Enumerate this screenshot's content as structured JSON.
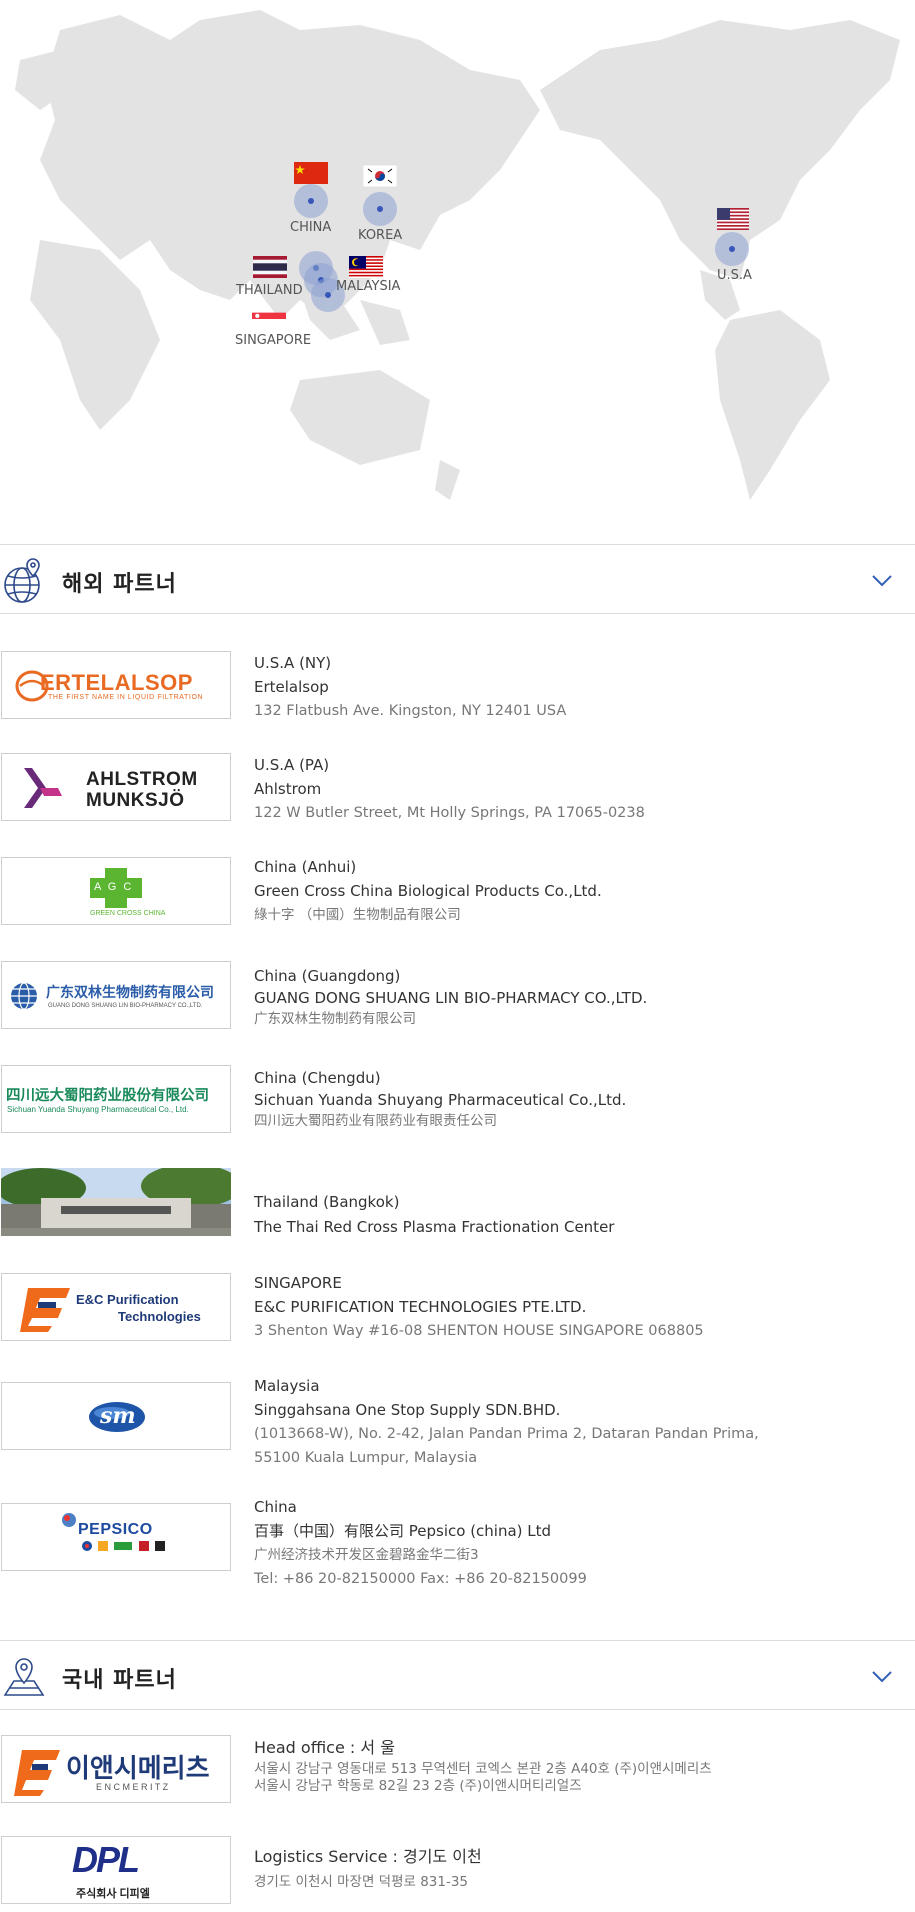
{
  "map": {
    "markers": [
      {
        "label": "CHINA",
        "flag": "china-flag"
      },
      {
        "label": "KOREA",
        "flag": "korea-flag"
      },
      {
        "label": "THAILAND",
        "flag": "thailand-flag"
      },
      {
        "label": "MALAYSIA",
        "flag": "malaysia-flag"
      },
      {
        "label": "SINGAPORE",
        "flag": "singapore-flag"
      },
      {
        "label": "U.S.A",
        "flag": "usa-flag"
      }
    ]
  },
  "overseas": {
    "title": "해외 파트너",
    "icon": "globe-pin-icon",
    "partners": [
      {
        "logo": "ertelalsop-logo",
        "logo_text": "ERTELALSOP",
        "logo_sub": "THE FIRST NAME IN LIQUID FILTRATION",
        "region": "U.S.A (NY)",
        "name": "Ertelalsop",
        "address": "132 Flatbush Ave. Kingston, NY 12401 USA"
      },
      {
        "logo": "ahlstrom-logo",
        "logo_text": "AHLSTROM",
        "logo_sub": "MUNKSJÖ",
        "region": "U.S.A (PA)",
        "name": "Ahlstrom",
        "address": "122 W Butler Street, Mt Holly Springs, PA 17065-0238"
      },
      {
        "logo": "green-cross-logo",
        "logo_text": "A G C",
        "logo_sub": "GREEN CROSS CHINA",
        "region": "China (Anhui)",
        "name": "Green Cross China  Biological Products Co.,Ltd.",
        "address": "綠十字 （中國）生物制品有限公司"
      },
      {
        "logo": "shuanglin-logo",
        "logo_text": "广东双林生物制药有限公司",
        "logo_sub": "GUANG DONG SHUANG LIN BIO-PHARMACY CO.,LTD.",
        "region": "China (Guangdong)",
        "name": "GUANG DONG SHUANG LIN BIO-PHARMACY CO.,LTD.",
        "address": "广东双林生物制药有限公司"
      },
      {
        "logo": "yuanda-logo",
        "logo_text": "四川远大蜀阳药业股份有限公司",
        "logo_sub": "Sichuan Yuanda Shuyang Pharmaceutical Co., Ltd.",
        "region": "China (Chengdu)",
        "name": "Sichuan Yuanda Shuyang Pharmaceutical Co.,Ltd.",
        "address": "四川远大蜀阳药业有限药业有眼责任公司"
      },
      {
        "logo": "thai-redcross-photo",
        "region": "Thailand (Bangkok)",
        "name": "The Thai Red Cross Plasma Fractionation Center"
      },
      {
        "logo": "enc-purification-logo",
        "logo_text": "E&C Purification",
        "logo_sub": "Technologies",
        "region": "SINGAPORE",
        "name": "E&C PURIFICATION TECHNOLOGIES PTE.LTD.",
        "address": "3 Shenton Way #16-08 SHENTON HOUSE SINGAPORE 068805"
      },
      {
        "logo": "sm-logo",
        "logo_text": "sm",
        "region": "Malaysia",
        "name": "Singgahsana One Stop Supply SDN.BHD.",
        "address": "(1013668-W), No. 2-42, Jalan  Pandan  Prima 2, Dataran Pandan Prima,",
        "address2": "55100  Kuala Lumpur, Malaysia"
      },
      {
        "logo": "pepsico-logo",
        "logo_text": "PEPSICO",
        "region": "China",
        "name": "百事（中国）有限公司 Pepsico (china) Ltd",
        "address": "广州经济技术开发区金碧路金华二街3",
        "address2": "Tel: +86 20-82150000 Fax: +86 20-82150099"
      }
    ]
  },
  "domestic": {
    "title": "국내 파트너",
    "icon": "map-pin-icon",
    "partners": [
      {
        "logo": "encmeritz-logo",
        "logo_text": "이앤시메리츠",
        "logo_sub": "E N C M E R I T Z",
        "region": "Head office :  서 울",
        "lines": [
          "서울시 강남구 영동대로 513 무역센터 코엑스 본관 2층 A40호 (주)이앤시메리츠",
          "서울시 강남구 학동로 82길 23 2층 (주)이앤시머티리얼즈"
        ]
      },
      {
        "logo": "dpl-logo",
        "logo_text": "DPL",
        "logo_sub": "주식회사 디피엘",
        "region": "Logistics Service : 경기도 이천",
        "lines": [
          "경기도 이천시 마장면 덕평로 831-35"
        ]
      }
    ]
  },
  "colors": {
    "accent": "#2f5fb5",
    "dot": "#3657b8",
    "enc_orange": "#f06a1c",
    "enc_navy": "#1f3a78",
    "pepsi_blue": "#1e4aa0",
    "ertel_orange": "#e96a22",
    "ahlstrom_purple": "#6a2a7a"
  }
}
